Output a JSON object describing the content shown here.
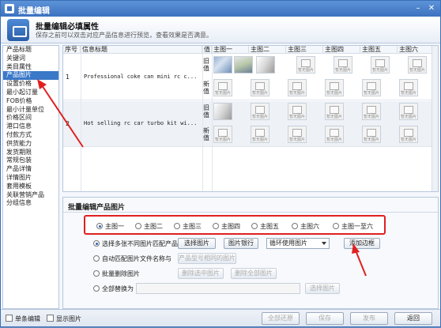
{
  "window": {
    "title": "批量编辑"
  },
  "header": {
    "title": "批量编辑必填属性",
    "subtitle": "保存之前可以双击对应产品信息进行预览，查看效果是否满意。"
  },
  "sidebar": {
    "active_index": 3,
    "items": [
      "产品标题",
      "关键词",
      "类目属性",
      "产品图片",
      "设置价格",
      "最小起订量",
      "FOB价格",
      "最小计量单位",
      "价格区间",
      "港口信息",
      "付款方式",
      "供货能力",
      "发货期限",
      "常规包装",
      "产品详情",
      "详情图片",
      "套用模板",
      "关联营销产品",
      "分组信息"
    ]
  },
  "grid": {
    "columns": [
      "序号",
      "信息标题",
      "值",
      "主图一",
      "主图二",
      "主图三",
      "主图四",
      "主图五",
      "主图六"
    ],
    "rows": [
      {
        "index": "1",
        "title": "Professional coke can mini rc c...",
        "old_label": "旧值",
        "new_label": "新值"
      },
      {
        "index": "2",
        "title": "Hot selling rc car turbo kit wi...",
        "old_label": "旧值",
        "new_label": "新值"
      }
    ],
    "placeholder_text": "暂无图片"
  },
  "bottom": {
    "title": "批量编辑产品图片",
    "radios": [
      "主图一",
      "主图二",
      "主图三",
      "主图四",
      "主图五",
      "主图六",
      "主图一至六"
    ],
    "selected_radio": 0,
    "options": [
      {
        "label": "选择多张不同图片匹配产品",
        "selected": true
      },
      {
        "label": "自动匹配图片文件名称与",
        "selected": false
      },
      {
        "label": "批量删除图片",
        "selected": false
      },
      {
        "label": "全部替换为",
        "selected": false
      }
    ],
    "buttons": {
      "select_image": "选择图片",
      "image_bank": "图片银行",
      "loop_select": "循环使用图片",
      "add_border": "添加边框",
      "model_match": "产品型号相同的图片",
      "delete_selected": "删除选中图片",
      "delete_all": "删除全部图片",
      "replace_select": "选择图片"
    }
  },
  "footer": {
    "single_edit": "单条编辑",
    "show_image": "显示图片",
    "restore_all": "全部还原",
    "save": "保存",
    "publish": "发布",
    "back": "返回"
  },
  "colors": {
    "accent": "#3a78c8",
    "highlight": "#e02020"
  }
}
